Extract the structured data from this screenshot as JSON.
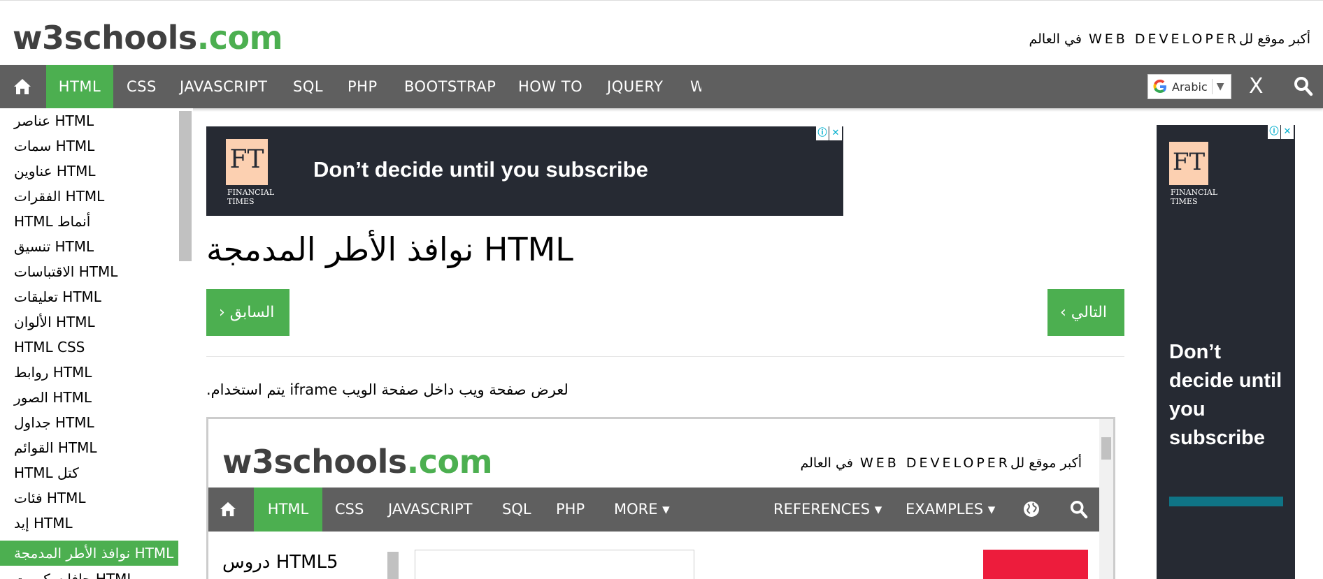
{
  "header": {
    "logo_main": "w3schools",
    "logo_dot": ".com",
    "tagline": "أكبر موقع للWEB DEVELOPER في العالم"
  },
  "navbar": {
    "items": [
      "HTML",
      "CSS",
      "JAVASCRIPT",
      "SQL",
      "PHP",
      "BOOTSTRAP",
      "HOW TO",
      "JQUERY",
      "W"
    ],
    "active": "HTML",
    "translate_label": "Arabic",
    "close_glyph": "X"
  },
  "sidebar": {
    "items": [
      "HTML عناصر",
      "HTML سمات",
      "HTML عناوين",
      "HTML الفقرات",
      "أنماط HTML",
      "HTML تنسيق",
      "HTML الاقتباسات",
      "HTML تعليقات",
      "HTML الألوان",
      "HTML CSS",
      "HTML روابط",
      "HTML الصور",
      "HTML جداول",
      "HTML القوائم",
      "كتل HTML",
      "HTML فئات",
      "HTML إيد",
      "HTML نوافذ الأطر المدمجة",
      "HTML جافا سكريبت"
    ],
    "active_index": 17
  },
  "ad_banner": {
    "logo": "FT",
    "brand_line1": "FINANCIAL",
    "brand_line2": "TIMES",
    "text": "Don’t decide until you subscribe"
  },
  "main": {
    "title": "HTML نوافذ الأطر المدمجة",
    "prev_button": "› السابق",
    "next_button": "‹ التالي",
    "intro": "لعرض صفحة ويب داخل صفحة الويب iframe يتم استخدام."
  },
  "iframe_example": {
    "logo_main": "w3schools",
    "logo_dot": ".com",
    "tagline": "أكبر موقع للWEB DEVELOPER في العالم",
    "nav_items": [
      "HTML",
      "CSS",
      "JAVASCRIPT",
      "SQL",
      "PHP",
      "MORE ▾",
      "REFERENCES ▾",
      "EXAMPLES ▾"
    ],
    "sidebar_title": "HTML5 دروس"
  },
  "side_ad": {
    "logo": "FT",
    "brand_line1": "FINANCIAL",
    "brand_line2": "TIMES",
    "text": "Don’t decide until you subscribe"
  },
  "colors": {
    "accent": "#4CAF50",
    "navbar": "#5f5f5f",
    "ad_bg": "#262a33"
  }
}
